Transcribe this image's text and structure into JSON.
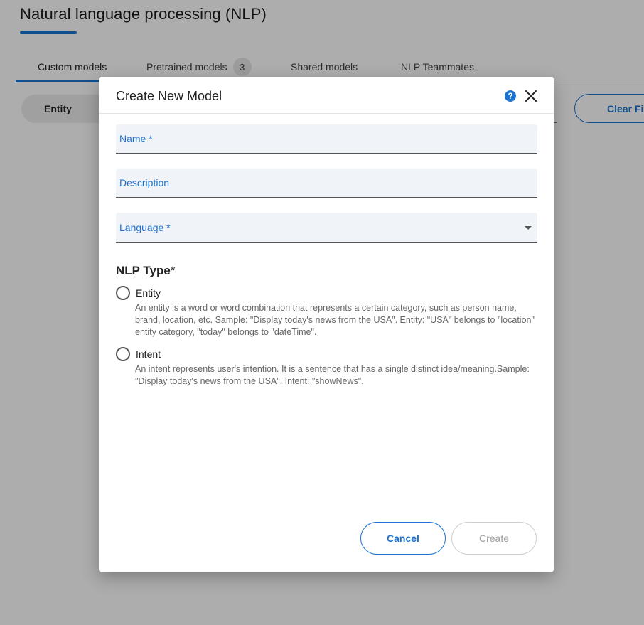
{
  "page": {
    "title": "Natural language processing (NLP)",
    "tabs": [
      {
        "label": "Custom models",
        "active": true
      },
      {
        "label": "Pretrained models",
        "count": "3"
      },
      {
        "label": "Shared models"
      },
      {
        "label": "NLP Teammates"
      }
    ],
    "filter_chip": "Entity",
    "clear_filter": "Clear Filter"
  },
  "dialog": {
    "title": "Create New Model",
    "help_icon": "?",
    "name_label": "Name *",
    "description_label": "Description",
    "language_label": "Language *",
    "nlp_type_title": "NLP Type",
    "nlp_type_required": "*",
    "options": [
      {
        "label": "Entity",
        "description": "An entity is a word or word combination that represents a certain category, such as person name, brand, location, etc. Sample: \"Display today's news from the USA\". Entity: \"USA\" belongs to \"location\" entity category, \"today\" belongs to \"dateTime\"."
      },
      {
        "label": "Intent",
        "description": "An intent represents user's intention. It is a sentence that has a single distinct idea/meaning.Sample: \"Display today's news from the USA\". Intent: \"showNews\"."
      }
    ],
    "cancel_label": "Cancel",
    "create_label": "Create"
  },
  "colors": {
    "accent": "#1a73d1",
    "overlay": "rgba(0,0,0,0.32)",
    "field_bg": "#f0f3f7"
  }
}
